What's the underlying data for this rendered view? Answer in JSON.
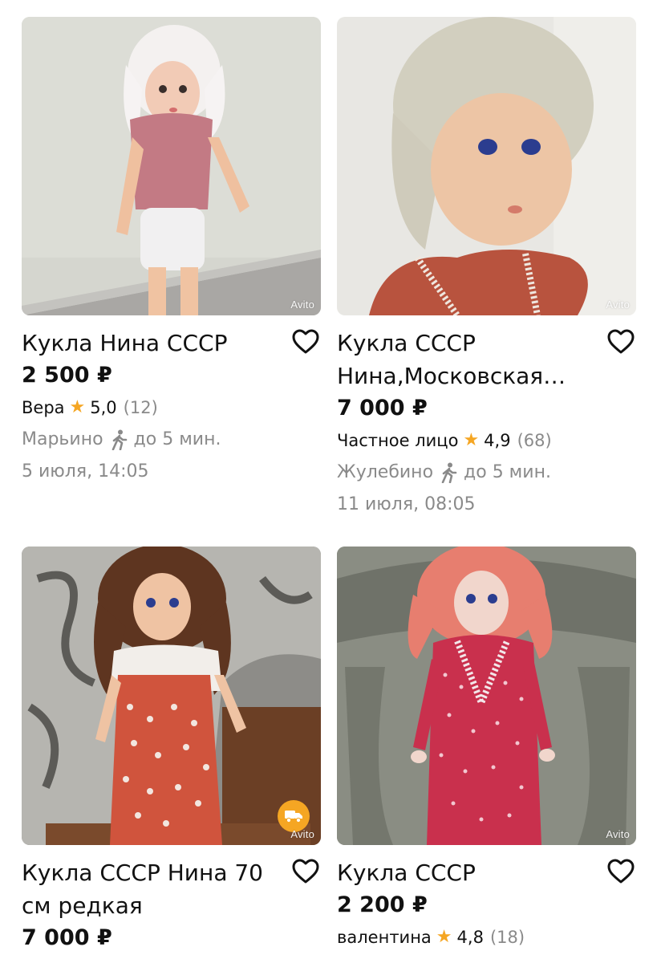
{
  "listings": [
    {
      "title": "Кукла Нина СССР",
      "price": "2 500 ₽",
      "seller": "Вера",
      "rating": "5,0",
      "reviews": "(12)",
      "location": "Марьино",
      "walk": "до 5 мин.",
      "date": "5 июля, 14:05",
      "watermark": "Avito",
      "favorite_icon": "heart-outline-icon"
    },
    {
      "title": "Кукла СССР Нина,Московская фабрика игрушек",
      "price": "7 000 ₽",
      "seller": "Частное лицо",
      "rating": "4,9",
      "reviews": "(68)",
      "location": "Жулебино",
      "walk": "до 5 мин.",
      "date": "11 июля, 08:05",
      "watermark": "Avito",
      "favorite_icon": "heart-outline-icon"
    },
    {
      "title": "Кукла СССР Нина 70 см редкая",
      "price": "7 000 ₽",
      "watermark": "Avito",
      "delivery_icon": "delivery-truck-icon",
      "favorite_icon": "heart-outline-icon"
    },
    {
      "title": "Кукла СССР",
      "price": "2 200 ₽",
      "seller": "валентина",
      "rating": "4,8",
      "reviews": "(18)",
      "watermark": "Avito",
      "favorite_icon": "heart-outline-icon"
    }
  ],
  "colors": {
    "star": "#f5a623",
    "muted": "#8a8a8a",
    "text": "#111111",
    "delivery_badge": "#f5a623"
  }
}
